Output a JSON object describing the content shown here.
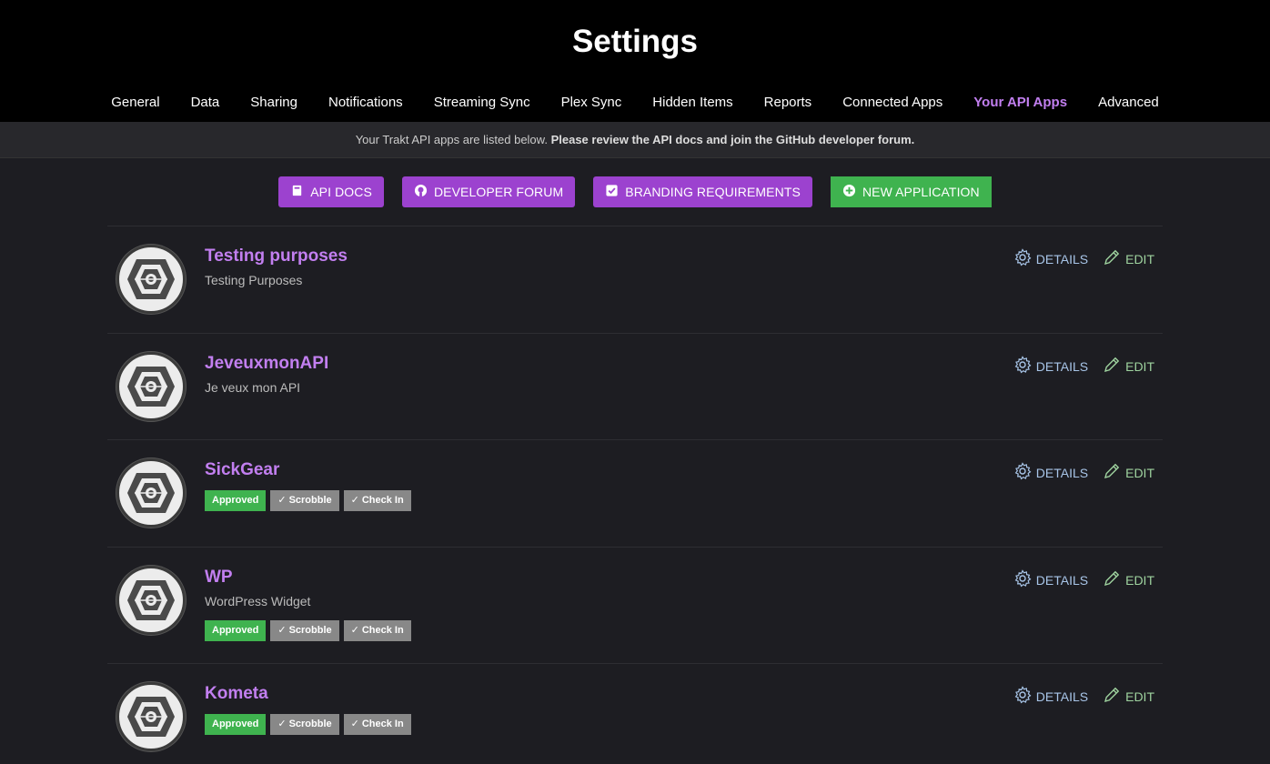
{
  "header": {
    "title": "Settings"
  },
  "tabs": [
    {
      "label": "General"
    },
    {
      "label": "Data"
    },
    {
      "label": "Sharing"
    },
    {
      "label": "Notifications"
    },
    {
      "label": "Streaming Sync"
    },
    {
      "label": "Plex Sync"
    },
    {
      "label": "Hidden Items"
    },
    {
      "label": "Reports"
    },
    {
      "label": "Connected Apps"
    },
    {
      "label": "Your API Apps"
    },
    {
      "label": "Advanced"
    }
  ],
  "info": {
    "prefix": "Your Trakt API apps are listed below.",
    "bold": "Please review the API docs and join the GitHub developer forum."
  },
  "actions": {
    "api_docs": "API DOCS",
    "developer_forum": "DEVELOPER FORUM",
    "branding": "BRANDING REQUIREMENTS",
    "new_app": "NEW APPLICATION"
  },
  "row_actions": {
    "details": "DETAILS",
    "edit": "EDIT"
  },
  "badges": {
    "approved": "Approved",
    "scrobble": "Scrobble",
    "checkin": "Check In"
  },
  "apps": [
    {
      "name": "Testing purposes",
      "description": "Testing Purposes"
    },
    {
      "name": "JeveuxmonAPI",
      "description": "Je veux mon API"
    },
    {
      "name": "SickGear",
      "description": ""
    },
    {
      "name": "WP",
      "description": "WordPress Widget"
    },
    {
      "name": "Kometa",
      "description": ""
    }
  ],
  "colors": {
    "accent": "#c27ff0",
    "button": "#9c42cf",
    "green": "#3fb34f"
  }
}
